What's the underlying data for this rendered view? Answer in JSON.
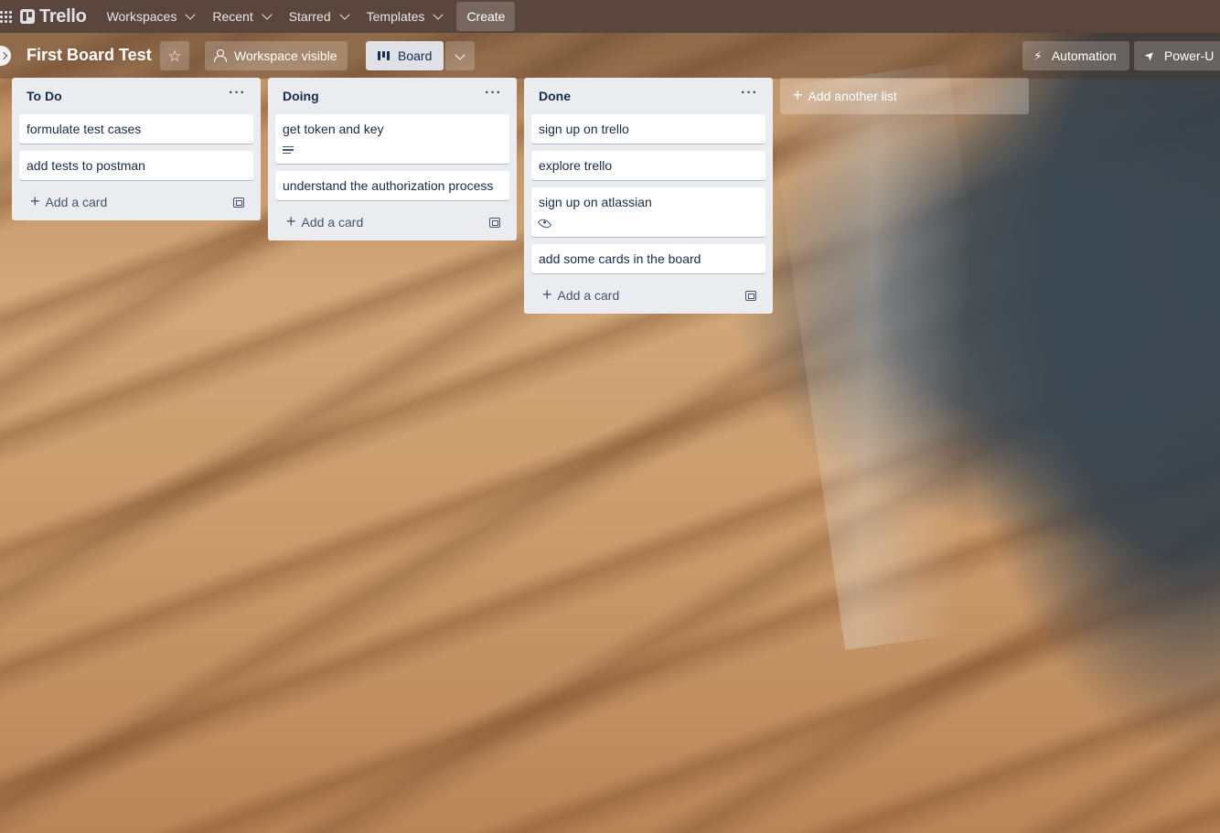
{
  "topnav": {
    "apps_icon": "apps-grid-icon",
    "logo_text": "Trello",
    "workspaces": "Workspaces",
    "recent": "Recent",
    "starred": "Starred",
    "templates": "Templates",
    "create": "Create",
    "background_color": "#5a463c"
  },
  "board_header": {
    "title": "First Board Test",
    "star_icon": "star-icon",
    "visibility": "Workspace visible",
    "view": "Board",
    "automation": "Automation",
    "powerups": "Power-U"
  },
  "lists": [
    {
      "title": "To Do",
      "cards": [
        {
          "title": "formulate test cases"
        },
        {
          "title": "add tests to postman"
        }
      ],
      "add_card": "Add a card"
    },
    {
      "title": "Doing",
      "cards": [
        {
          "title": "get token and key",
          "badge": "description-icon"
        },
        {
          "title": "understand the authorization process"
        }
      ],
      "add_card": "Add a card"
    },
    {
      "title": "Done",
      "cards": [
        {
          "title": "sign up on trello"
        },
        {
          "title": "explore trello"
        },
        {
          "title": "sign up on atlassian",
          "badge": "watch-icon"
        },
        {
          "title": "add some cards in the board"
        }
      ],
      "add_card": "Add a card"
    }
  ],
  "add_list": "Add another list",
  "colors": {
    "list_bg": "#ebecf0",
    "text": "#172b4d",
    "muted": "#44546f"
  }
}
